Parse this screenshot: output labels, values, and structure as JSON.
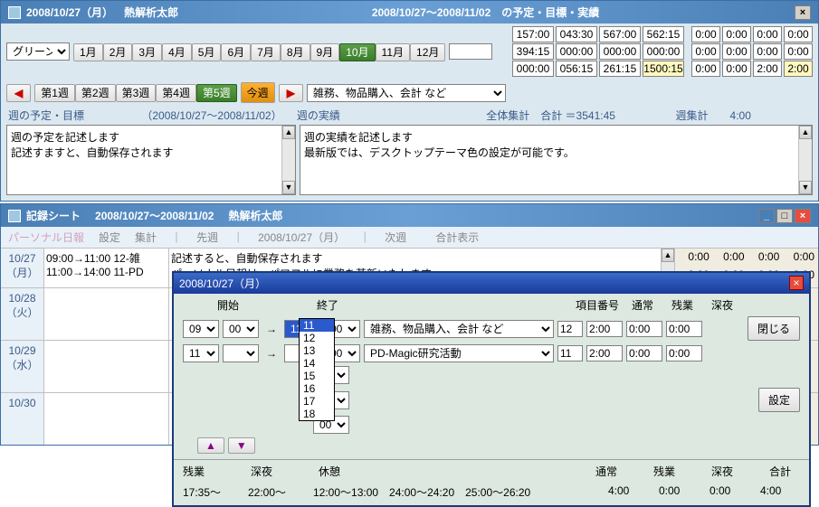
{
  "win1": {
    "title_date": "2008/10/27（月）",
    "title_name": "熱解析太郎",
    "title_range": "2008/10/27～2008/11/02　の予定・目標・実績",
    "color_select": "グリーン",
    "months": [
      "1月",
      "2月",
      "3月",
      "4月",
      "5月",
      "6月",
      "7月",
      "8月",
      "9月",
      "10月",
      "11月",
      "12月"
    ],
    "active_month_index": 9,
    "year": "2008",
    "weeks": [
      "第1週",
      "第2週",
      "第3週",
      "第4週",
      "第5週"
    ],
    "active_week_index": 4,
    "today": "今週",
    "category": "雑務、物品購入、会計 など",
    "time_grid_top": [
      [
        "157:00",
        "043:30",
        "567:00",
        "562:15"
      ],
      [
        "394:15",
        "000:00",
        "000:00",
        "000:00"
      ],
      [
        "000:00",
        "056:15",
        "261:15",
        "1500:15"
      ]
    ],
    "time_grid_right": [
      [
        "0:00",
        "0:00",
        "0:00",
        "0:00"
      ],
      [
        "0:00",
        "0:00",
        "0:00",
        "0:00"
      ],
      [
        "0:00",
        "0:00",
        "2:00",
        "2:00"
      ]
    ],
    "sh_left": "週の予定・目標",
    "sh_left_range": "（2008/10/27～2008/11/02）",
    "sh_mid": "週の実績",
    "sh_total": "全体集計　合計 ＝3541:45",
    "sh_week": "週集計　　4:00",
    "ta_left_l1": "週の予定を記述します",
    "ta_left_l2": "記述すますと、自動保存されます",
    "ta_right_l1": "週の実績を記述します",
    "ta_right_l2": "最新版では、デスクトップテーマ色の設定が可能です。"
  },
  "win2": {
    "title_prefix": "記録シート",
    "title_range": "2008/10/27～2008/11/02",
    "title_name": "熱解析太郎",
    "menu": [
      "パーソナル日報",
      "設定",
      "集計",
      "｜",
      "先週",
      "｜",
      "2008/10/27（月）",
      "｜",
      "次週",
      "",
      "合計表示"
    ],
    "days": [
      {
        "date": "10/27",
        "dow": "（月）",
        "lines": [
          "09:00→11:00 12-雑",
          "11:00→14:00 11-PD"
        ],
        "desc_l1": "記述すると、自動保存されます",
        "desc_l2": "パーソナル日報は、パワフルに業務を革新いたします",
        "times": [
          "0:00",
          "0:00",
          "0:00",
          "0:00",
          "0:00",
          "0:00",
          "0:00",
          "0:00"
        ]
      },
      {
        "date": "10/28",
        "dow": "（火）",
        "lines": [],
        "times": []
      },
      {
        "date": "10/29",
        "dow": "（水）",
        "lines": [],
        "times": []
      },
      {
        "date": "10/30",
        "dow": "",
        "lines": [],
        "times": []
      }
    ]
  },
  "popup": {
    "title": "2008/10/27（月）",
    "h_start": "開始",
    "h_end": "終了",
    "h_itemno": "項目番号",
    "h_normal": "通常",
    "h_over": "残業",
    "h_late": "深夜",
    "rows": [
      {
        "sh": "09",
        "sm": "00",
        "eh": "11",
        "em": "00",
        "item": "雑務、物品購入、会計 など",
        "no": "12",
        "n": "2:00",
        "o": "0:00",
        "l": "0:00"
      },
      {
        "sh": "11",
        "sm": "",
        "eh": "",
        "em": "00",
        "item": "PD-Magic研究活動",
        "no": "11",
        "n": "2:00",
        "o": "0:00",
        "l": "0:00"
      },
      {
        "sh": "",
        "sm": "",
        "eh": "",
        "em": "00",
        "item": "",
        "no": "",
        "n": "",
        "o": "",
        "l": ""
      },
      {
        "sh": "",
        "sm": "",
        "eh": "",
        "em": "00",
        "item": "",
        "no": "",
        "n": "",
        "o": "",
        "l": ""
      },
      {
        "sh": "",
        "sm": "",
        "eh": "",
        "em": "00",
        "item": "",
        "no": "",
        "n": "",
        "o": "",
        "l": ""
      }
    ],
    "btn_close": "閉じる",
    "btn_settings": "設定",
    "dd_options": [
      "11",
      "12",
      "13",
      "14",
      "15",
      "16",
      "17",
      "18"
    ],
    "dd_selected": "11",
    "bottom_over": "残業",
    "bottom_late": "深夜",
    "bottom_rest": "休憩",
    "f_over": "17:35～",
    "f_late": "22:00～",
    "f_rest": "12:00～13:00　24:00～24:20　25:00～26:20",
    "f_normal_h": "通常",
    "f_over_h": "残業",
    "f_late_h": "深夜",
    "f_total_h": "合計",
    "f_normal": "4:00",
    "f_over_v": "0:00",
    "f_late_v": "0:00",
    "f_total": "4:00"
  }
}
